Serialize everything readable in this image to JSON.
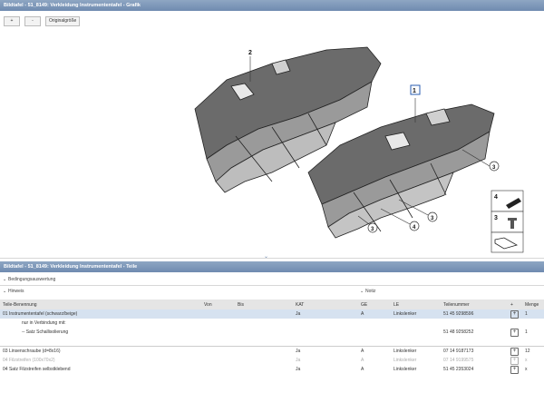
{
  "window": {
    "graphic_title": "Bildtafel - 51_8149: Verkleidung Instrumententafel - Grafik",
    "parts_title": "Bildtafel - 51_8149: Verkleidung Instrumententafel - Teile"
  },
  "toolbar": {
    "zoom_in": "+",
    "zoom_out": "-",
    "original_size": "Originalgröße"
  },
  "callouts": {
    "c1": "1",
    "c2": "2",
    "c3a": "3",
    "c3b": "3",
    "c3c": "3",
    "c4": "4",
    "c3d": "3",
    "legend4": "4",
    "legend3": "3"
  },
  "filters": {
    "conditions": "Bedingungsauswertung",
    "note": "Hinweis",
    "notiz": "Notiz"
  },
  "table": {
    "headers": [
      "Teile-Benennung",
      "Von",
      "Bis",
      "KAT",
      "GE",
      "LE",
      "Teilenummer",
      "+",
      "Menge"
    ],
    "rows": [
      {
        "name": "01 Instrumententafel (schwarz/beige)",
        "von": "",
        "bis": "",
        "kat": "Ja",
        "ge": "A",
        "le": "Linkslenker",
        "nr": "51 45 9298596",
        "add": "+",
        "menge": "1"
      },
      {
        "name": "nur in Verbindung mit:",
        "von": "",
        "bis": "",
        "kat": "",
        "ge": "",
        "le": "",
        "nr": "",
        "add": "",
        "menge": ""
      },
      {
        "name": "-- Satz Schallisolierung",
        "von": "",
        "bis": "",
        "kat": "",
        "ge": "",
        "le": "",
        "nr": "51 48 9258252",
        "add": "+",
        "menge": "1"
      },
      {
        "name": "",
        "von": "",
        "bis": "",
        "kat": "",
        "ge": "",
        "le": "",
        "nr": "",
        "add": "",
        "menge": ""
      },
      {
        "name": "03 Linsenschraube (d=8x16)",
        "von": "",
        "bis": "",
        "kat": "Ja",
        "ge": "A",
        "le": "Linkslenker",
        "nr": "07 14 9187173",
        "add": "+",
        "menge": "12"
      },
      {
        "name": "04 Filzstreifen (100x70x2)",
        "von": "",
        "bis": "",
        "kat": "Ja",
        "ge": "A",
        "le": "Linkslenker",
        "nr": "07 14 9199575",
        "add": "+",
        "menge": "x"
      },
      {
        "name": "04 Satz Filzstreifen selbstklebend",
        "von": "",
        "bis": "",
        "kat": "Ja",
        "ge": "A",
        "le": "Linkslenker",
        "nr": "51 45 2353024",
        "add": "+",
        "menge": "x"
      }
    ]
  }
}
